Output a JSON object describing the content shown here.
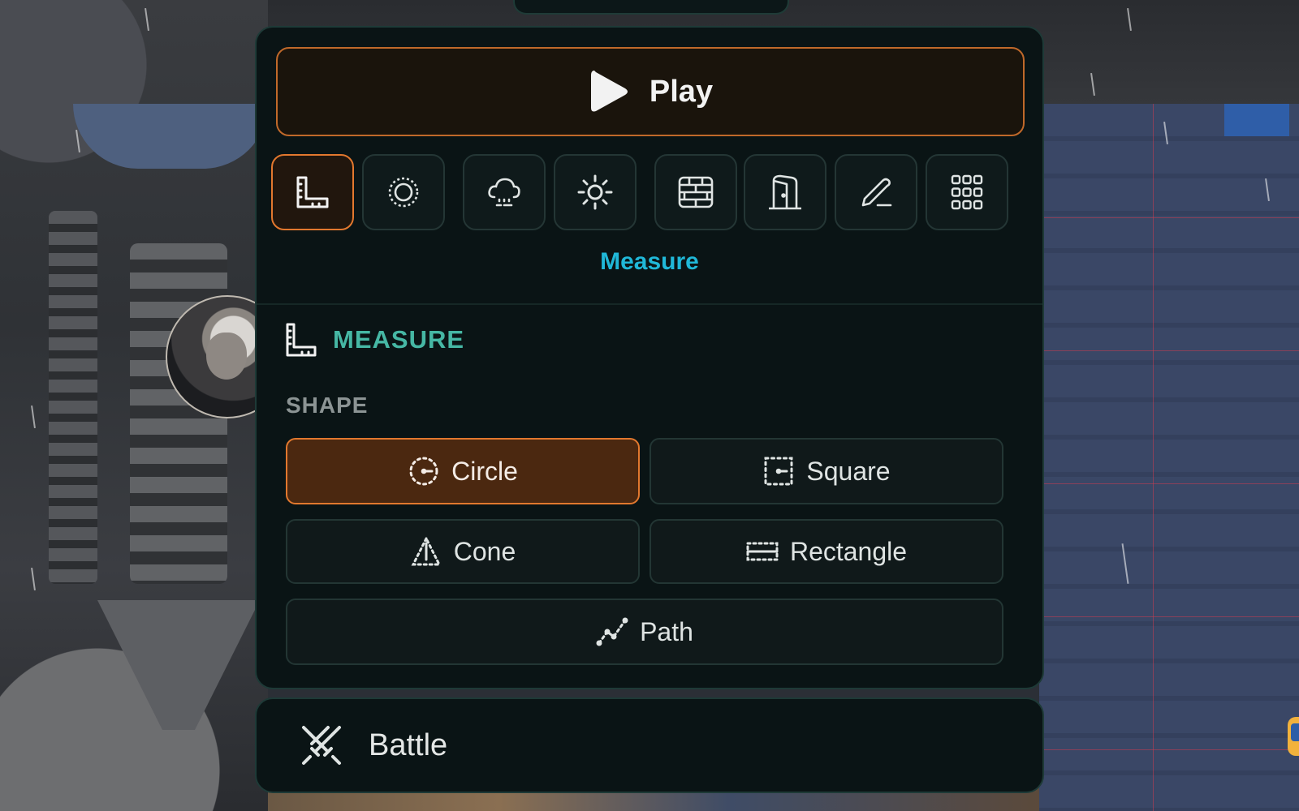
{
  "play": {
    "label": "Play"
  },
  "toolbar": {
    "tools": [
      {
        "name": "measure",
        "icon": "ruler-icon",
        "active": true
      },
      {
        "name": "aura",
        "icon": "target-circle-icon",
        "active": false
      },
      {
        "name": "weather",
        "icon": "weather-cloud-icon",
        "active": false
      },
      {
        "name": "lighting",
        "icon": "sun-icon",
        "active": false
      },
      {
        "name": "walls",
        "icon": "brick-wall-icon",
        "active": false
      },
      {
        "name": "doors",
        "icon": "door-icon",
        "active": false
      },
      {
        "name": "draw",
        "icon": "pencil-icon",
        "active": false
      },
      {
        "name": "more",
        "icon": "grid-dots-icon",
        "active": false
      }
    ],
    "active_caption": "Measure"
  },
  "measure_section": {
    "title": "MEASURE",
    "shape_label": "SHAPE",
    "shapes": [
      {
        "label": "Circle",
        "icon": "dotted-circle-icon",
        "selected": true
      },
      {
        "label": "Square",
        "icon": "dotted-square-icon",
        "selected": false
      },
      {
        "label": "Cone",
        "icon": "dotted-cone-icon",
        "selected": false
      },
      {
        "label": "Rectangle",
        "icon": "dotted-rectangle-icon",
        "selected": false
      },
      {
        "label": "Path",
        "icon": "dotted-path-icon",
        "selected": false
      }
    ]
  },
  "battle": {
    "label": "Battle",
    "icon": "crossed-swords-icon"
  },
  "colors": {
    "accent_orange": "#e2782e",
    "caption_cyan": "#20b8d8",
    "section_teal": "#46b7a4",
    "panel_bg": "#0a1415"
  }
}
